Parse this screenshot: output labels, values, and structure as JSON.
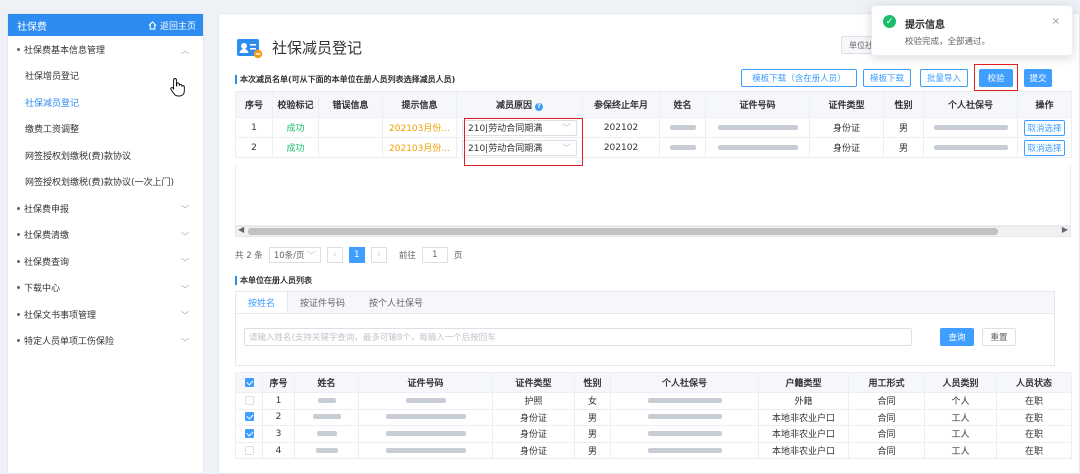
{
  "sidebar": {
    "title": "社保费",
    "home_label": "返回主页",
    "items": [
      {
        "label": "社保费基本信息管理",
        "level": "group",
        "chev": "︿"
      },
      {
        "label": "社保增员登记",
        "level": "sub"
      },
      {
        "label": "社保减员登记",
        "level": "sub",
        "active": true
      },
      {
        "label": "缴费工资调整",
        "level": "sub"
      },
      {
        "label": "网签授权划缴税(费)款协议",
        "level": "sub"
      },
      {
        "label": "网签授权划缴税(费)款协议(一次上门)",
        "level": "sub"
      },
      {
        "label": "社保费申报",
        "level": "group",
        "chev": "﹀"
      },
      {
        "label": "社保费清缴",
        "level": "group",
        "chev": "﹀"
      },
      {
        "label": "社保费查询",
        "level": "group",
        "chev": "﹀"
      },
      {
        "label": "下载中心",
        "level": "group",
        "chev": "﹀"
      },
      {
        "label": "社保文书事项管理",
        "level": "group",
        "chev": "﹀"
      },
      {
        "label": "特定人员单项工伤保险",
        "level": "group",
        "chev": "﹀"
      }
    ]
  },
  "page": {
    "title": "社保减员登记",
    "unit_btn": "单位社"
  },
  "section1": {
    "title": "本次减员名单(可从下面的本单位在册人员列表选择减员人员)"
  },
  "toolbar": {
    "tpl_with_staff": "模板下载（含在册人员）",
    "tpl": "模板下载",
    "batch_import": "批量导入",
    "verify": "校验",
    "submit": "提交"
  },
  "table1": {
    "headers": [
      "序号",
      "校验标记",
      "错误信息",
      "提示信息",
      "减员原因",
      "参保终止年月",
      "姓名",
      "证件号码",
      "证件类型",
      "性别",
      "个人社保号",
      "操作"
    ],
    "rows": [
      {
        "no": "1",
        "mark": "成功",
        "error": "",
        "hint": "202103月份...",
        "reason": "210|劳动合同期满",
        "end": "202102",
        "idtype": "身份证",
        "sex": "男",
        "op": "取消选择"
      },
      {
        "no": "2",
        "mark": "成功",
        "error": "",
        "hint": "202103月份...",
        "reason": "210|劳动合同期满",
        "end": "202102",
        "idtype": "身份证",
        "sex": "男",
        "op": "取消选择"
      }
    ]
  },
  "pager": {
    "total": "共 2 条",
    "size": "10条/页",
    "page": "1",
    "goto": "前往",
    "goto_val": "1",
    "unit": "页"
  },
  "section2": {
    "title": "本单位在册人员列表"
  },
  "tabs": [
    "按姓名",
    "按证件号码",
    "按个人社保号"
  ],
  "search": {
    "placeholder": "请输入姓名(支持关键字查询，最多可输8个，每输入一个后按回车",
    "query": "查询",
    "reset": "重置"
  },
  "table2": {
    "headers": [
      "序号",
      "姓名",
      "证件号码",
      "证件类型",
      "性别",
      "个人社保号",
      "户籍类型",
      "用工形式",
      "人员类别",
      "人员状态"
    ],
    "rows": [
      {
        "no": "1",
        "checked": false,
        "idtype": "护照",
        "sex": "女",
        "huji": "外籍",
        "form": "合同",
        "cat": "个人",
        "status": "在职"
      },
      {
        "no": "2",
        "checked": true,
        "idtype": "身份证",
        "sex": "男",
        "huji": "本地非农业户口",
        "form": "合同",
        "cat": "工人",
        "status": "在职"
      },
      {
        "no": "3",
        "checked": true,
        "idtype": "身份证",
        "sex": "男",
        "huji": "本地非农业户口",
        "form": "合同",
        "cat": "工人",
        "status": "在职"
      },
      {
        "no": "4",
        "checked": false,
        "idtype": "身份证",
        "sex": "男",
        "huji": "本地非农业户口",
        "form": "合同",
        "cat": "工人",
        "status": "在职"
      }
    ]
  },
  "toast": {
    "title": "提示信息",
    "message": "校验完成，全部通过。",
    "close": "×"
  }
}
